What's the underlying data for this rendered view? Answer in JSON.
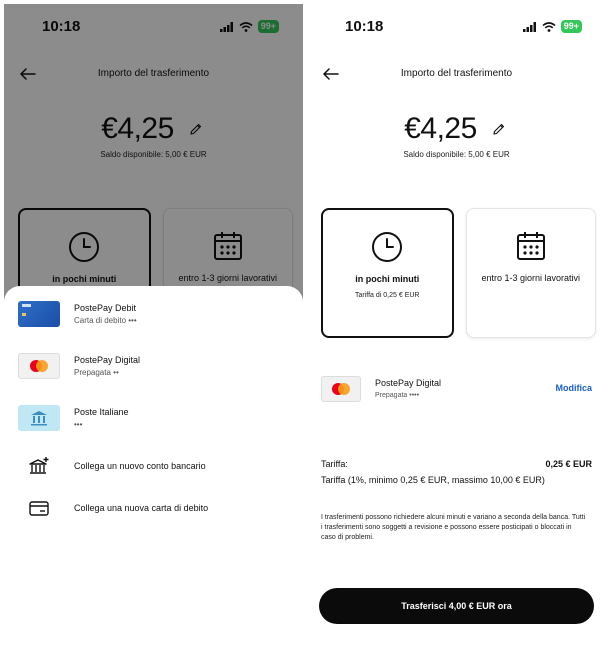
{
  "status": {
    "time": "10:18",
    "battery": "99+"
  },
  "header": {
    "title": "Importo del trasferimento"
  },
  "amount": {
    "value": "€4,25",
    "balance": "Saldo disponibile: 5,00 € EUR"
  },
  "options": {
    "fast_title": "in pochi minuti",
    "fast_fee": "Tariffa di 0,25 € EUR",
    "standard_title": "entro 1-3 giorni lavorativi"
  },
  "sheet": {
    "items": [
      {
        "title": "PostePay Debit",
        "sub": "Carta di debito •••"
      },
      {
        "title": "PostePay Digital",
        "sub": "Prepagata ••"
      },
      {
        "title": "Poste Italiane",
        "sub": "•••"
      }
    ],
    "actions": [
      {
        "label": "Collega un nuovo conto bancario"
      },
      {
        "label": "Collega una nuova carta di debito"
      }
    ]
  },
  "payment": {
    "title": "PostePay Digital",
    "sub": "Prepagata ••••",
    "modify": "Modifica"
  },
  "fee": {
    "label": "Tariffa:",
    "value": "0,25 € EUR",
    "detail": "Tariffa (1%, minimo 0,25 € EUR, massimo 10,00 € EUR)"
  },
  "disclaimer": "I trasferimenti possono richiedere alcuni minuti e variano a seconda della banca. Tutti i trasferimenti sono soggetti a revisione e possono essere posticipati o bloccati in caso di problemi.",
  "cta": {
    "label": "Trasferisci 4,00 € EUR ora"
  },
  "colors": {
    "accent": "#1a5fc8",
    "battery": "#34c759",
    "cta_bg": "#0b0b0b",
    "overlay": "rgba(0,0,0,0.45)"
  }
}
